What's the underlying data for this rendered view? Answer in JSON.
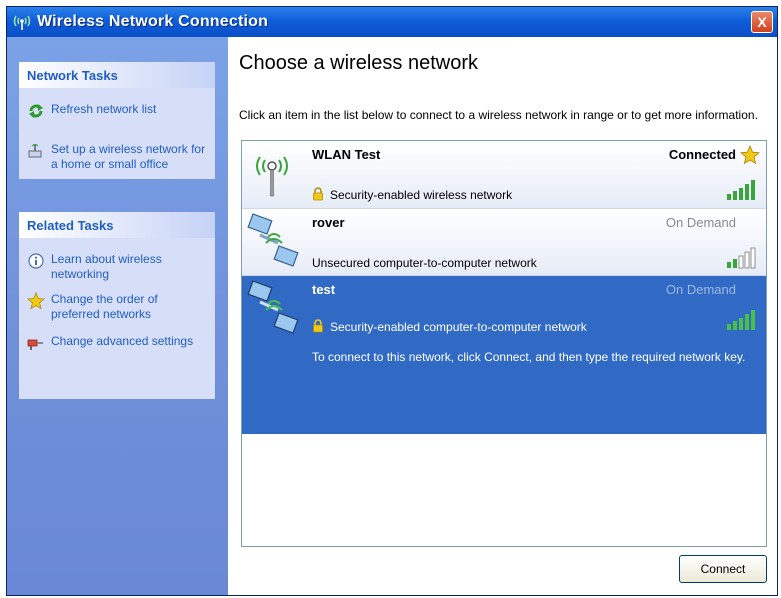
{
  "window": {
    "title": "Wireless Network Connection",
    "close_label": "X"
  },
  "sidebar": {
    "network_tasks": {
      "header": "Network Tasks",
      "items": [
        {
          "label": "Refresh network list",
          "icon": "refresh-icon"
        },
        {
          "label": "Set up a wireless network for a home or small office",
          "icon": "setup-network-icon"
        }
      ]
    },
    "related_tasks": {
      "header": "Related Tasks",
      "items": [
        {
          "label": "Learn about wireless networking",
          "icon": "info-icon"
        },
        {
          "label": "Change the order of preferred networks",
          "icon": "star-icon"
        },
        {
          "label": "Change advanced settings",
          "icon": "settings-icon"
        }
      ]
    }
  },
  "main": {
    "heading": "Choose a wireless network",
    "instructions": "Click an item in the list below to connect to a wireless network in range or to get more information.",
    "networks": [
      {
        "ssid": "WLAN Test",
        "status": "Connected",
        "description": "Security-enabled wireless network",
        "secured": true,
        "signal_bars": 5,
        "selected": false
      },
      {
        "ssid": "rover",
        "status": "On Demand",
        "description": "Unsecured computer-to-computer network",
        "secured": false,
        "signal_bars": 2,
        "selected": false
      },
      {
        "ssid": "test",
        "status": "On Demand",
        "description": "Security-enabled computer-to-computer network",
        "secured": true,
        "signal_bars": 5,
        "selected": true,
        "detail": "To connect to this network, click Connect, and then type the required network key."
      }
    ],
    "connect_label": "Connect"
  },
  "colors": {
    "titlebar": "#0a4fc8",
    "sidebar": "#6f8fd9",
    "panel_text": "#215dc6",
    "selection": "#316ac5",
    "signal_green": "#3aa53a"
  }
}
